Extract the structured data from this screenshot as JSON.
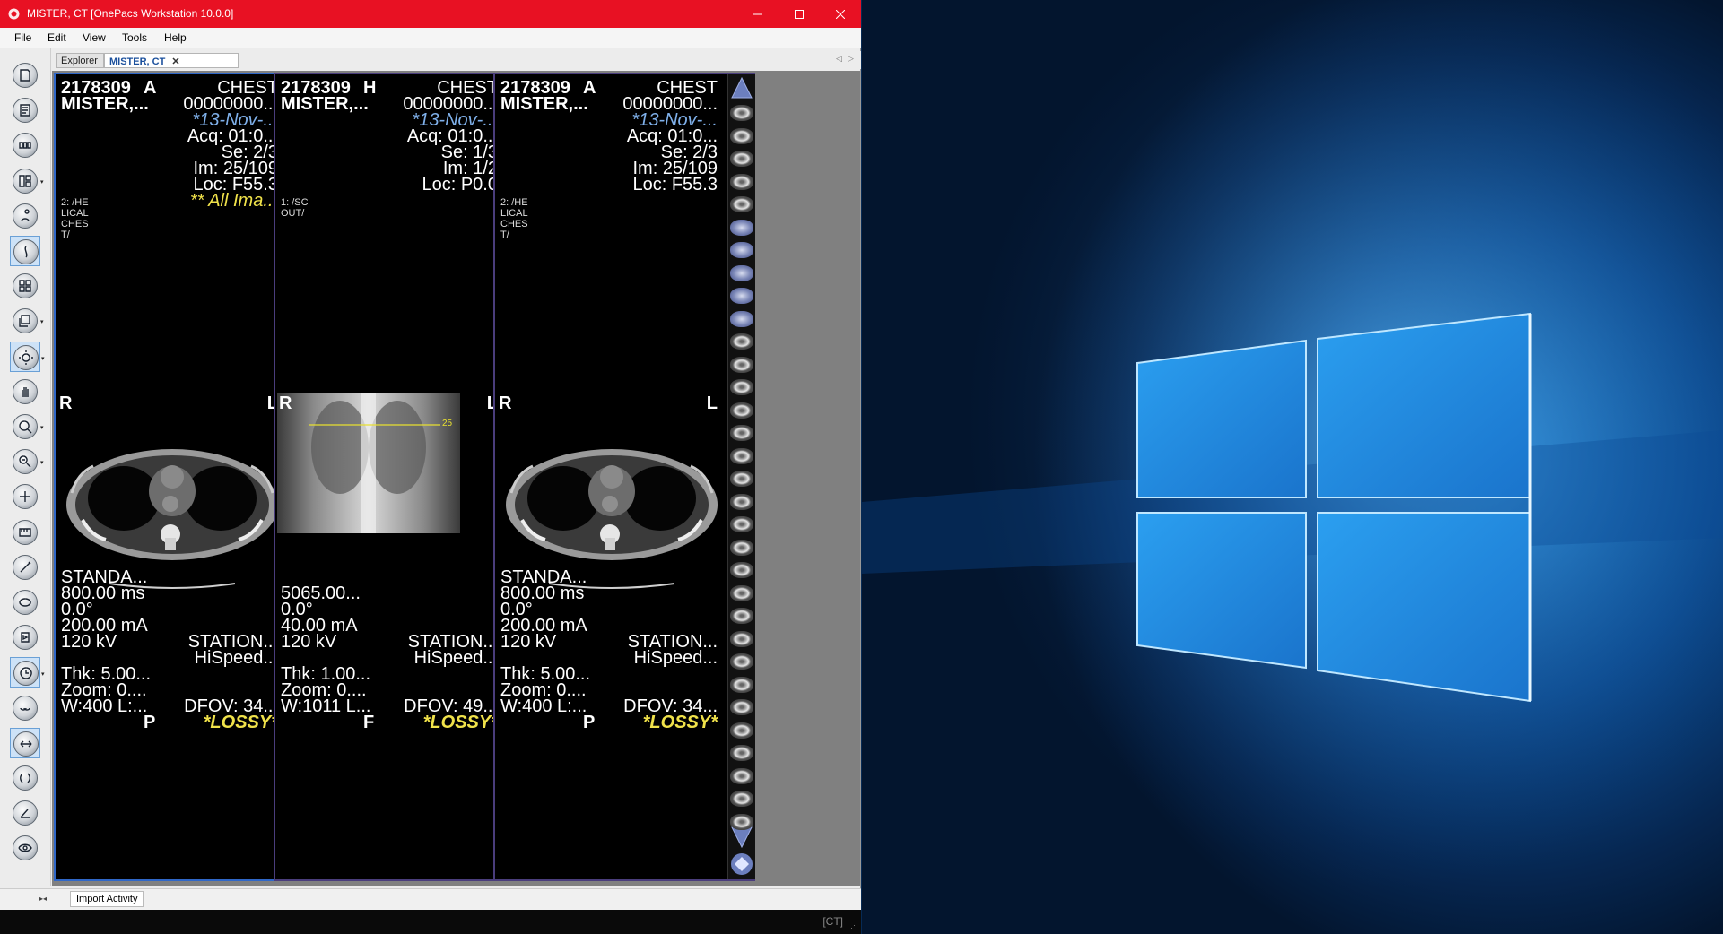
{
  "window": {
    "title": "MISTER, CT [OnePacs Workstation 10.0.0]"
  },
  "menu": [
    "File",
    "Edit",
    "View",
    "Tools",
    "Help"
  ],
  "tabs": {
    "explorer": "Explorer",
    "study": "MISTER, CT"
  },
  "viewports": [
    {
      "id": "2178309",
      "orient": "A",
      "body": "CHEST",
      "name": "MISTER,...",
      "mrn": "00000000...",
      "date": "*13-Nov-...",
      "acq": "Acq: 01:0...",
      "se": "Se: 2/3",
      "im": "Im: 25/109",
      "loc": "Loc: F55.3",
      "allimg": "** All Ima...",
      "series_desc": [
        "2: /HE",
        "LICAL",
        "CHES",
        "T/"
      ],
      "left": "R",
      "right": "L",
      "bottom_marker": "P",
      "params": [
        "STANDA...",
        "800.00 ms",
        "0.0°",
        "200.00 mA",
        "120 kV"
      ],
      "station": "STATION...",
      "model": "HiSpeed...",
      "thk": "Thk: 5.00...",
      "zoom": "Zoom: 0....",
      "wl": "W:400 L:...",
      "dfov": "DFOV: 34...",
      "lossy": "*LOSSY*",
      "image": "axial"
    },
    {
      "id": "2178309",
      "orient": "H",
      "body": "CHEST",
      "name": "MISTER,...",
      "mrn": "00000000...",
      "date": "*13-Nov-...",
      "acq": "Acq: 01:0...",
      "se": "Se: 1/3",
      "im": "Im: 1/2",
      "loc": "Loc: P0.0",
      "allimg": "",
      "series_desc": [
        "1: /SC",
        "OUT/"
      ],
      "left": "R",
      "right": "L",
      "bottom_marker": "F",
      "line_label": "25",
      "params": [
        "5065.00...",
        "0.0°",
        "40.00 mA",
        "120 kV"
      ],
      "station": "STATION...",
      "model": "HiSpeed...",
      "thk": "Thk: 1.00...",
      "zoom": "Zoom: 0....",
      "wl": "W:1011 L...",
      "dfov": "DFOV: 49...",
      "lossy": "*LOSSY*",
      "image": "scout"
    },
    {
      "id": "2178309",
      "orient": "A",
      "body": "CHEST",
      "name": "MISTER,...",
      "mrn": "00000000...",
      "date": "*13-Nov-...",
      "acq": "Acq: 01:0...",
      "se": "Se: 2/3",
      "im": "Im: 25/109",
      "loc": "Loc: F55.3",
      "allimg": "",
      "series_desc": [
        "2: /HE",
        "LICAL",
        "CHES",
        "T/"
      ],
      "left": "R",
      "right": "L",
      "bottom_marker": "P",
      "params": [
        "STANDA...",
        "800.00 ms",
        "0.0°",
        "200.00 mA",
        "120 kV"
      ],
      "station": "STATION...",
      "model": "HiSpeed...",
      "thk": "Thk: 5.00...",
      "zoom": "Zoom: 0....",
      "wl": "W:400 L:...",
      "dfov": "DFOV: 34...",
      "lossy": "*LOSSY*",
      "image": "axial"
    }
  ],
  "import_tab": "Import Activity",
  "status": {
    "modality": "[CT]"
  },
  "tools": [
    "document-icon",
    "report-icon",
    "layout-icon",
    "hanging-icon",
    "person-icon",
    "window-level-icon",
    "grid-icon",
    "stack-icon",
    "sun-icon",
    "pan-hand-icon",
    "zoom-icon",
    "magnify-icon",
    "probe-icon",
    "ruler-icon",
    "pen-icon",
    "ellipse-icon",
    "cine-icon",
    "clock-icon",
    "link-icon",
    "arrows-icon",
    "invert-icon",
    "angle-icon",
    "eye-icon"
  ],
  "colors": {
    "titlebar": "#e81123",
    "viewport_selected": "#2f67c8",
    "overlay_blue": "#7fb0ea",
    "overlay_yellow": "#f0e24a"
  }
}
